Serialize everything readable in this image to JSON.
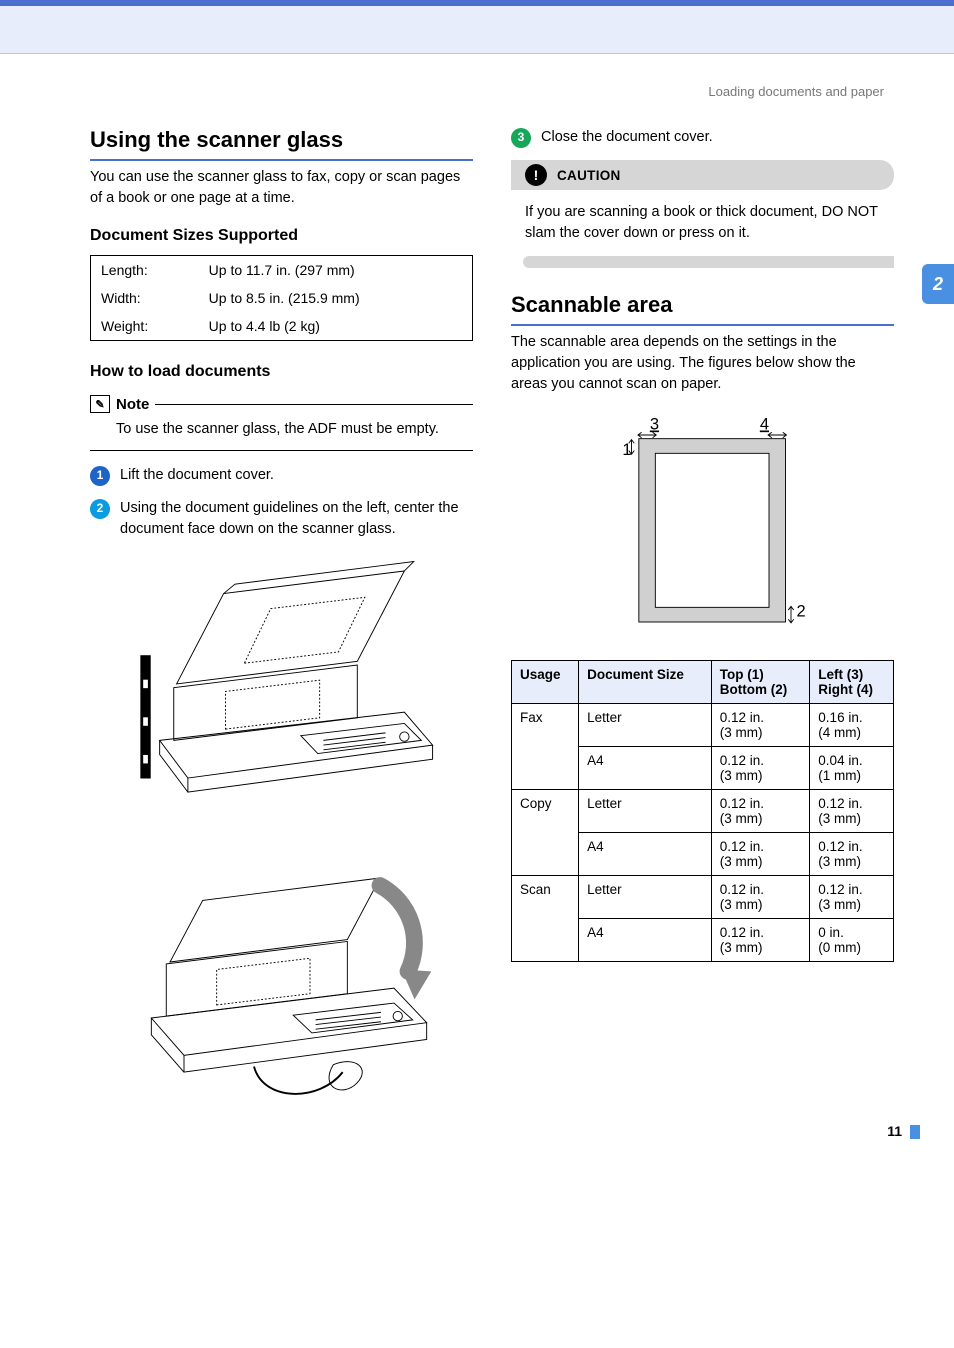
{
  "breadcrumb": "Loading documents and paper",
  "chapter_tab": "2",
  "page_number": "11",
  "left": {
    "heading": "Using the scanner glass",
    "intro": "You can use the scanner glass to fax, copy or scan pages of a book or one page at a time.",
    "sizes_heading": "Document Sizes Supported",
    "sizes": {
      "length_label": "Length:",
      "length_value": "Up to 11.7 in. (297 mm)",
      "width_label": "Width:",
      "width_value": "Up to 8.5 in. (215.9 mm)",
      "weight_label": "Weight:",
      "weight_value": "Up to 4.4 lb (2 kg)"
    },
    "howto_heading": "How to load documents",
    "note_label": "Note",
    "note_text": "To use the scanner glass, the ADF must be empty.",
    "steps": {
      "s1": "Lift the document cover.",
      "s2": "Using the document guidelines on the left, center the document face down on the scanner glass."
    }
  },
  "right": {
    "step3": "Close the document cover.",
    "caution_label": "CAUTION",
    "caution_text": "If you are scanning a book or thick document, DO NOT slam the cover down or press on it.",
    "scan_heading": "Scannable area",
    "scan_intro": "The scannable area depends on the settings in the application you are using. The figures below show the areas you cannot scan on paper.",
    "diagram_labels": {
      "one": "1",
      "two": "2",
      "three": "3",
      "four": "4"
    },
    "table": {
      "head": {
        "usage": "Usage",
        "docsize": "Document Size",
        "top": "Top (1)",
        "bottom": "Bottom (2)",
        "left": "Left (3)",
        "right": "Right (4)"
      },
      "rows": [
        {
          "usage": "Fax",
          "size": "Letter",
          "tb1": "0.12 in.",
          "tb2": "(3 mm)",
          "lr1": "0.16 in.",
          "lr2": "(4 mm)"
        },
        {
          "usage": "",
          "size": "A4",
          "tb1": "0.12 in.",
          "tb2": "(3 mm)",
          "lr1": "0.04 in.",
          "lr2": "(1 mm)"
        },
        {
          "usage": "Copy",
          "size": "Letter",
          "tb1": "0.12 in.",
          "tb2": "(3 mm)",
          "lr1": "0.12 in.",
          "lr2": "(3 mm)"
        },
        {
          "usage": "",
          "size": "A4",
          "tb1": "0.12 in.",
          "tb2": "(3 mm)",
          "lr1": "0.12 in.",
          "lr2": "(3 mm)"
        },
        {
          "usage": "Scan",
          "size": "Letter",
          "tb1": "0.12 in.",
          "tb2": "(3 mm)",
          "lr1": "0.12 in.",
          "lr2": "(3 mm)"
        },
        {
          "usage": "",
          "size": "A4",
          "tb1": "0.12 in.",
          "tb2": "(3 mm)",
          "lr1": "0 in.",
          "lr2": "(0 mm)"
        }
      ]
    }
  }
}
